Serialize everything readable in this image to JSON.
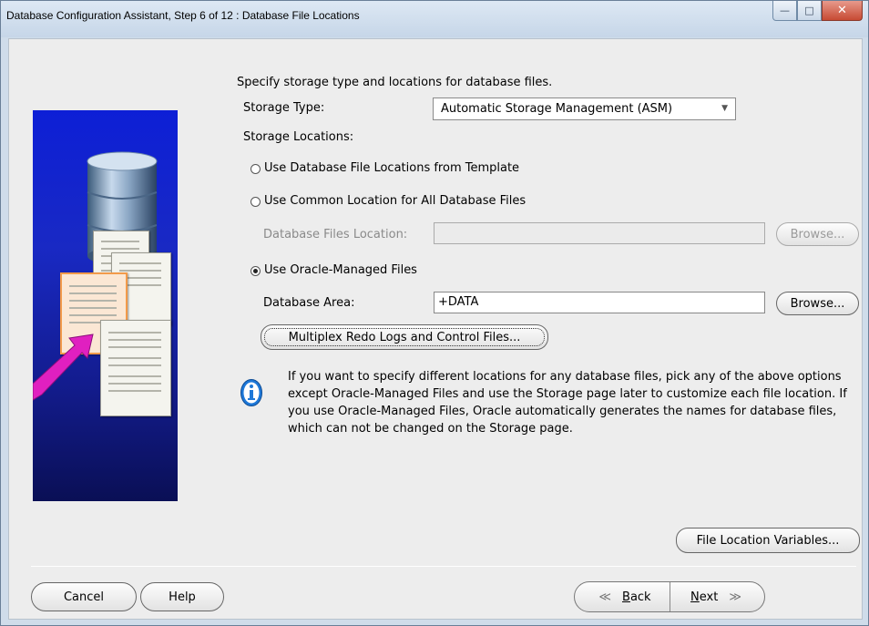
{
  "window": {
    "title": "Database Configuration Assistant, Step 6 of 12 : Database File Locations",
    "minimize_glyph": "—",
    "maximize_glyph": "□",
    "close_glyph": "✕"
  },
  "content": {
    "intro": "Specify storage type and locations for database files.",
    "storage_type_label": "Storage Type:",
    "storage_type_value": "Automatic Storage Management (ASM)",
    "storage_locations_label": "Storage Locations:",
    "radio_template": "Use Database File Locations from Template",
    "radio_common": "Use Common Location for All Database Files",
    "db_files_location_label": "Database Files Location:",
    "db_files_location_value": "",
    "browse_label": "Browse...",
    "radio_omf": "Use Oracle-Managed Files",
    "database_area_label": "Database Area:",
    "database_area_value": "+DATA",
    "multiplex_button": "Multiplex Redo Logs and Control Files...",
    "info_text": "If you want to specify different locations for any database files, pick any of the above options except Oracle-Managed Files and use the Storage page later to customize each file location. If you use Oracle-Managed Files, Oracle automatically generates the names for database files, which can not be changed on the Storage page.",
    "file_location_variables_button": "File Location Variables..."
  },
  "footer": {
    "cancel": "Cancel",
    "help": "Help",
    "back_glyph": "≪",
    "back_mnemonic": "B",
    "back_rest": "ack",
    "next_mnemonic": "N",
    "next_rest": "ext",
    "next_glyph": "≫"
  },
  "selected_option": "radio_omf",
  "colors": {
    "panel_blue": "#1524c8",
    "info_icon": "#1e78d8",
    "arrow_pink": "#e020c0"
  },
  "icons": [
    "database-cylinder-icon",
    "document-icon",
    "pink-arrow-icon",
    "info-icon"
  ]
}
